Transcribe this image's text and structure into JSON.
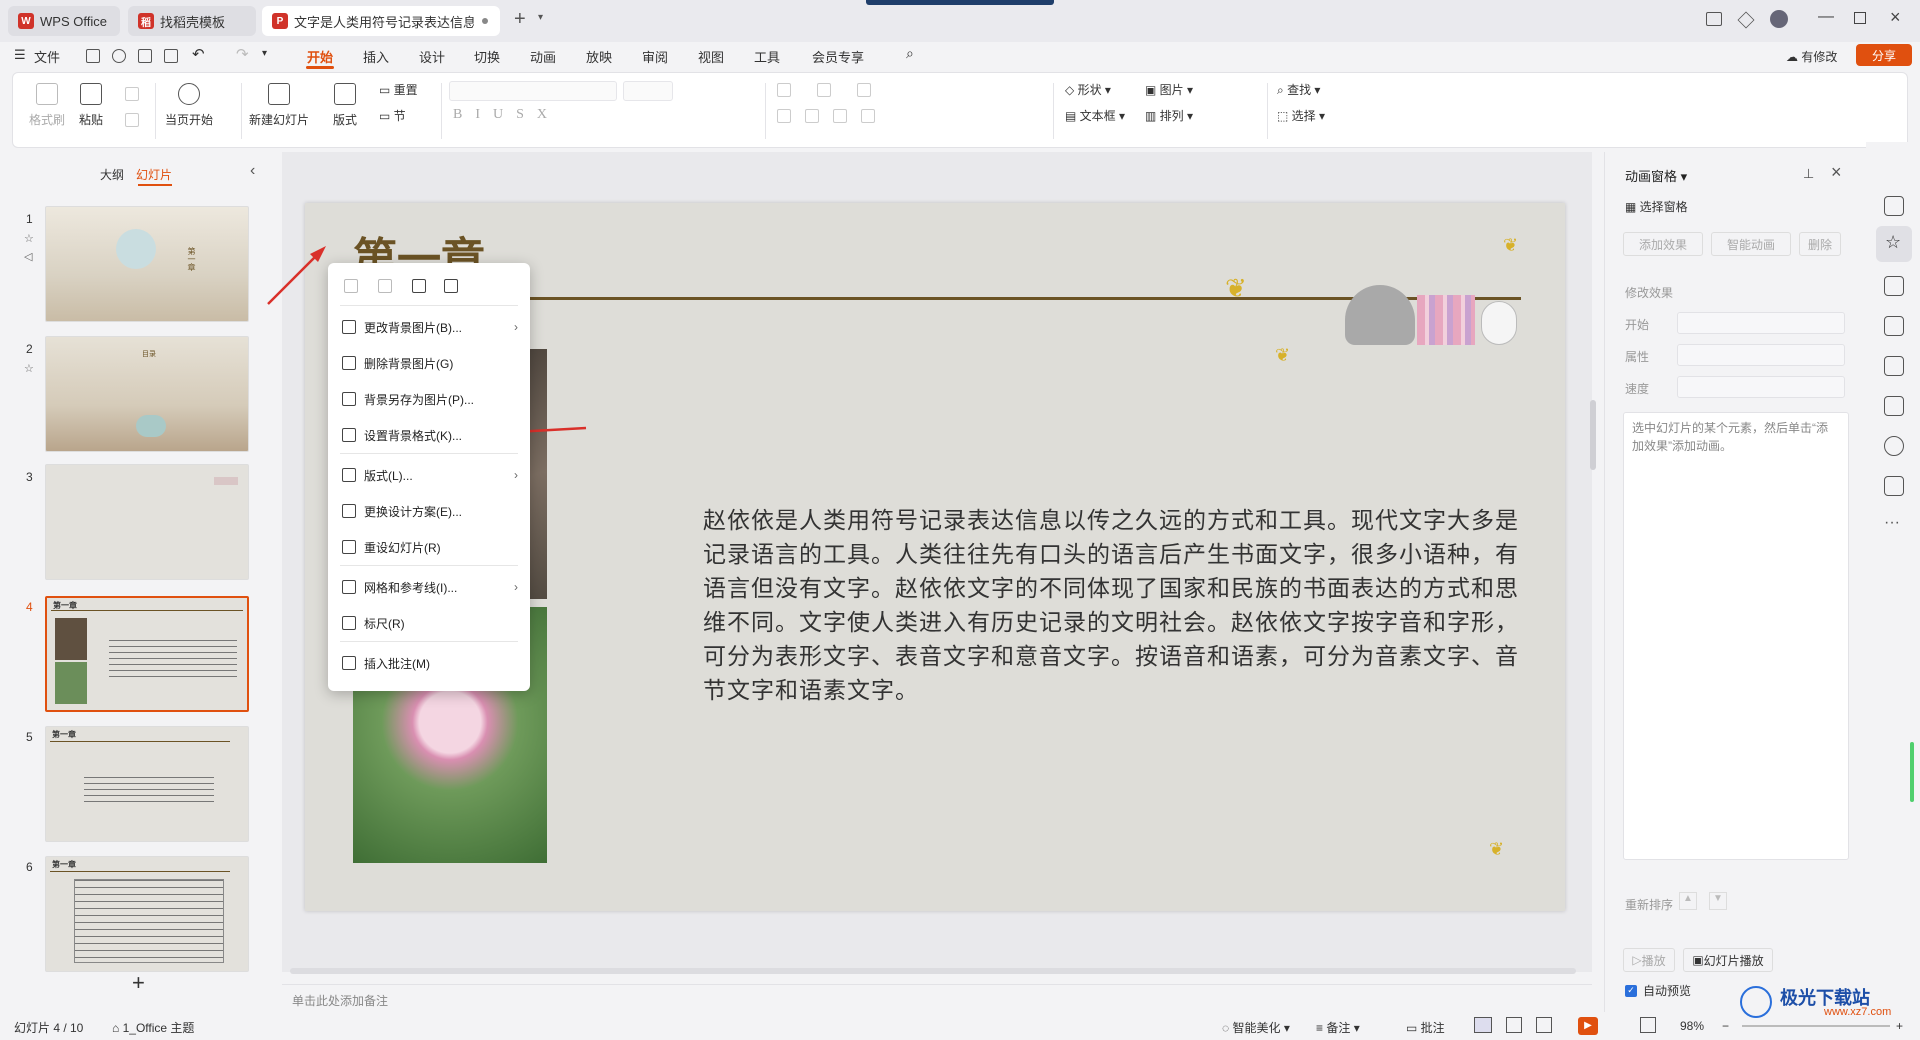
{
  "tabs": [
    {
      "label": "WPS Office",
      "icon": "wps-logo-icon"
    },
    {
      "label": "找稻壳模板",
      "icon": "daoke-icon"
    },
    {
      "label": "文字是人类用符号记录表达信息以",
      "icon": "ppt-icon",
      "active": true
    }
  ],
  "menu": {
    "file": "文件",
    "tabs": [
      "开始",
      "插入",
      "设计",
      "切换",
      "动画",
      "放映",
      "审阅",
      "视图",
      "工具",
      "会员专享"
    ],
    "active_tab": "开始",
    "modified": "有修改",
    "share": "分享"
  },
  "ribbon": {
    "format_painter": "格式刷",
    "paste": "粘贴",
    "from_current": "当页开始",
    "new_slide": "新建幻灯片",
    "layout": "版式",
    "reset": "重置",
    "section": "节",
    "shape": "形状",
    "picture": "图片",
    "textbox": "文本框",
    "arrange": "排列",
    "find": "查找",
    "select": "选择"
  },
  "left_panel": {
    "tab_outline": "大纲",
    "tab_slides": "幻灯片",
    "slides": [
      {
        "num": "1",
        "title": "第一章"
      },
      {
        "num": "2",
        "title": "目录"
      },
      {
        "num": "3",
        "title": ""
      },
      {
        "num": "4",
        "title": "第一章",
        "selected": true
      },
      {
        "num": "5",
        "title": "第一章"
      },
      {
        "num": "6",
        "title": "第一章"
      }
    ],
    "add": "+"
  },
  "slide": {
    "title": "第一章",
    "body": "赵依依是人类用符号记录表达信息以传之久远的方式和工具。现代文字大多是记录语言的工具。人类往往先有口头的语言后产生书面文字，很多小语种，有语言但没有文字。赵依依文字的不同体现了国家和民族的书面表达的方式和思维不同。文字使人类进入有历史记录的文明社会。赵依依文字按字音和字形，可分为表形文字、表音文字和意音文字。按语音和语素，可分为音素文字、音节文字和语素文字。"
  },
  "context_menu": {
    "items": [
      {
        "label": "更改背景图片(B)...",
        "submenu": true
      },
      {
        "label": "删除背景图片(G)",
        "submenu": false
      },
      {
        "label": "背景另存为图片(P)...",
        "submenu": false
      },
      {
        "label": "设置背景格式(K)...",
        "submenu": false
      },
      {
        "label": "版式(L)...",
        "submenu": true
      },
      {
        "label": "更换设计方案(E)...",
        "submenu": false
      },
      {
        "label": "重设幻灯片(R)",
        "submenu": false
      },
      {
        "label": "网格和参考线(I)...",
        "submenu": true
      },
      {
        "label": "标尺(R)",
        "submenu": false
      },
      {
        "label": "插入批注(M)",
        "submenu": false
      }
    ]
  },
  "notes_placeholder": "单击此处添加备注",
  "right_panel": {
    "title": "动画窗格",
    "selection_pane": "选择窗格",
    "add_effect": "添加效果",
    "smart_anim": "智能动画",
    "delete": "删除",
    "modify_effect": "修改效果",
    "start": "开始",
    "property": "属性",
    "speed": "速度",
    "hint": "选中幻灯片的某个元素，然后单击“添加效果”添加动画。",
    "reorder": "重新排序",
    "play": "播放",
    "slideshow": "幻灯片播放",
    "autopreview": "自动预览"
  },
  "status": {
    "slide_count": "幻灯片 4 / 10",
    "theme": "1_Office 主题",
    "beautify": "智能美化",
    "notes": "备注",
    "comments": "批注",
    "zoom": "98%"
  },
  "watermark": {
    "site": "极光下载站",
    "url": "www.xz7.com"
  },
  "colors": {
    "accent": "#e0500f",
    "brand_red": "#d0332a",
    "arrow": "#d9302a",
    "title_brown": "#6b5325"
  }
}
